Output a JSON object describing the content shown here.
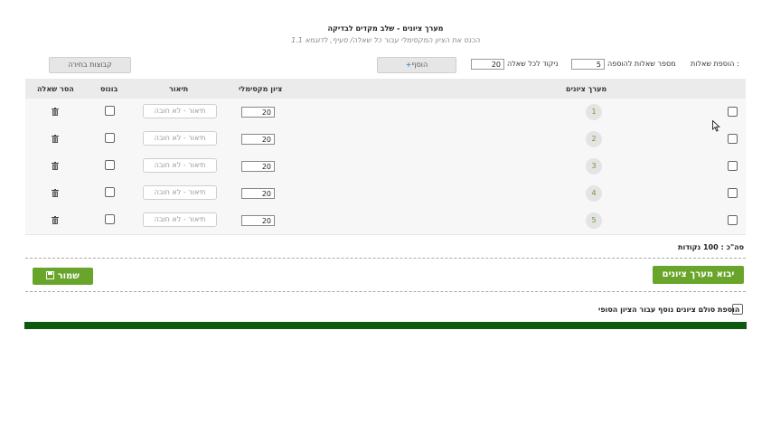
{
  "header": {
    "title": "מערך ציונים - שלב מקדים לבדיקה",
    "subtitle": "הכנס את הציון המקסימלי עבור כל שאלה/ סעיף, לדוגמא 1.1"
  },
  "controls": {
    "add_questions_label": "הוספת שאלות :",
    "num_questions_label": "מספר שאלות להוספה",
    "num_questions_value": "5",
    "score_per_question_label": "ניקוד לכל שאלה",
    "score_per_question_value": "20",
    "add_button_label": "הוסף",
    "elective_groups_button_label": "קבוצות בחירה"
  },
  "table": {
    "columns": {
      "grade_array": "מערך ציונים",
      "max_grade": "ציון מקסימלי",
      "description": "תיאור",
      "bonus": "בונוס",
      "remove": "הסר שאלה"
    },
    "description_placeholder": "תיאור - לא חובה",
    "rows": [
      {
        "number": "1",
        "max_grade": "20"
      },
      {
        "number": "2",
        "max_grade": "20"
      },
      {
        "number": "3",
        "max_grade": "20"
      },
      {
        "number": "4",
        "max_grade": "20"
      },
      {
        "number": "5",
        "max_grade": "20"
      }
    ]
  },
  "total_label": "סה\"כ : 100 נקודות",
  "actions": {
    "import_label": "יבוא מערך ציונים",
    "save_label": "שמור"
  },
  "extra_option_label": "הוספת סולם ציונים נוסף עבור הציון הסופי",
  "colors": {
    "accent_green": "#6aa52b",
    "bottom_bar": "#0e5a0e"
  },
  "icons": {
    "add": "plus-icon",
    "remove": "trash-icon",
    "save": "save-icon"
  }
}
